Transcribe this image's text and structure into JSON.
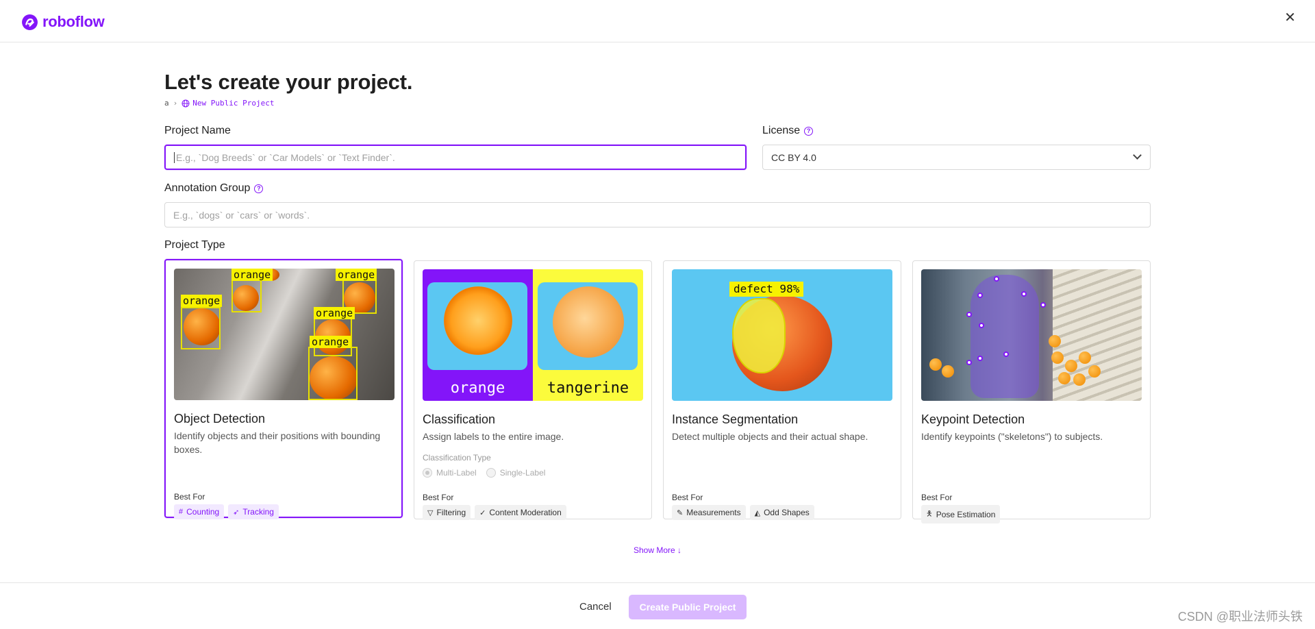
{
  "brand": {
    "name": "roboflow",
    "color": "#8315f9"
  },
  "page": {
    "title": "Let's create your project.",
    "breadcrumb": {
      "workspace": "a",
      "current": "New Public Project"
    }
  },
  "form": {
    "project_name": {
      "label": "Project Name",
      "placeholder": "E.g., `Dog Breeds` or `Car Models` or `Text Finder`."
    },
    "license": {
      "label": "License",
      "value": "CC BY 4.0"
    },
    "annotation_group": {
      "label": "Annotation Group",
      "placeholder": "E.g., `dogs` or `cars` or `words`."
    },
    "project_type_label": "Project Type"
  },
  "project_types": [
    {
      "title": "Object Detection",
      "description": "Identify objects and their positions with bounding boxes.",
      "best_for_label": "Best For",
      "tags": [
        {
          "label": "Counting",
          "icon": "hash-icon"
        },
        {
          "label": "Tracking",
          "icon": "tracking-icon"
        }
      ],
      "image_labels": [
        "orange",
        "orange",
        "orange",
        "orange",
        "orange"
      ],
      "selected": true
    },
    {
      "title": "Classification",
      "description": "Assign labels to the entire image.",
      "classification_type_label": "Classification Type",
      "options": [
        "Multi-Label",
        "Single-Label"
      ],
      "best_for_label": "Best For",
      "tags": [
        {
          "label": "Filtering",
          "icon": "filter-icon"
        },
        {
          "label": "Content Moderation",
          "icon": "check-icon"
        }
      ],
      "image_labels": [
        "orange",
        "tangerine"
      ]
    },
    {
      "title": "Instance Segmentation",
      "description": "Detect multiple objects and their actual shape.",
      "best_for_label": "Best For",
      "tags": [
        {
          "label": "Measurements",
          "icon": "ruler-icon"
        },
        {
          "label": "Odd Shapes",
          "icon": "shapes-icon"
        }
      ],
      "image_labels": [
        "defect 98%"
      ]
    },
    {
      "title": "Keypoint Detection",
      "description": "Identify keypoints (\"skeletons\") to subjects.",
      "best_for_label": "Best For",
      "tags": [
        {
          "label": "Pose Estimation",
          "icon": "person-icon"
        }
      ]
    }
  ],
  "show_more": "Show More",
  "footer": {
    "cancel": "Cancel",
    "create": "Create Public Project"
  },
  "watermark": "CSDN @职业法师头铁"
}
